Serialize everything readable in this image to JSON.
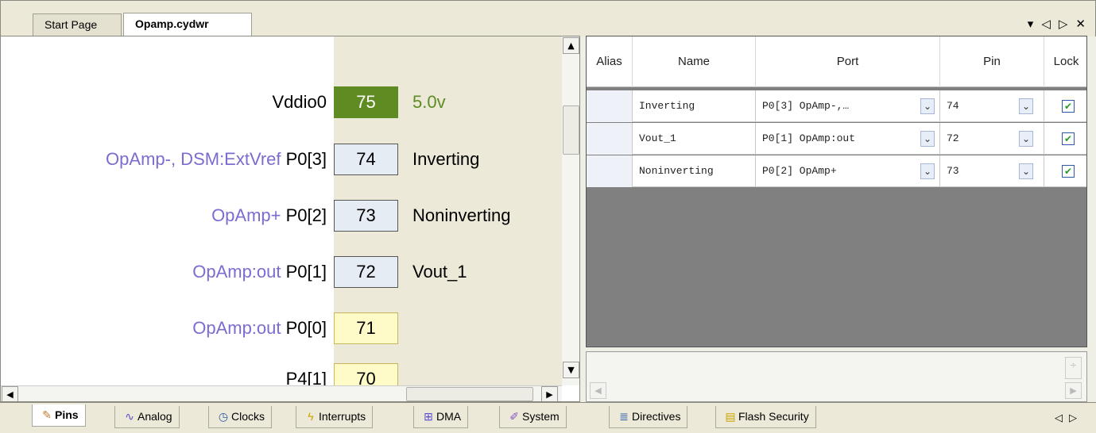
{
  "doc_tabs": [
    {
      "label": "Start Page"
    },
    {
      "label": "Opamp.cydwr"
    }
  ],
  "window_controls": {
    "dropdown": "▾",
    "prev": "◁",
    "next": "▷",
    "close": "✕"
  },
  "pins": [
    {
      "func": "",
      "port": "Vddio0",
      "number": "75",
      "name": "5.0v",
      "style": "green"
    },
    {
      "func": "OpAmp-, DSM:ExtVref",
      "port": "P0[3]",
      "number": "74",
      "name": "Inverting",
      "style": "assigned"
    },
    {
      "func": "OpAmp+",
      "port": "P0[2]",
      "number": "73",
      "name": "Noninverting",
      "style": "assigned"
    },
    {
      "func": "OpAmp:out",
      "port": "P0[1]",
      "number": "72",
      "name": "Vout_1",
      "style": "assigned"
    },
    {
      "func": "OpAmp:out",
      "port": "P0[0]",
      "number": "71",
      "name": "",
      "style": "free"
    },
    {
      "func": "",
      "port": "P4[1]",
      "number": "70",
      "name": "",
      "style": "free"
    }
  ],
  "grid": {
    "headers": {
      "alias": "Alias",
      "name": "Name",
      "port": "Port",
      "pin": "Pin",
      "lock": "Lock"
    },
    "rows": [
      {
        "alias": "",
        "name": "Inverting",
        "port": "P0[3] OpAmp-,…",
        "pin": "74",
        "locked": true
      },
      {
        "alias": "",
        "name": "Vout_1",
        "port": "P0[1] OpAmp:out",
        "pin": "72",
        "locked": true
      },
      {
        "alias": "",
        "name": "Noninverting",
        "port": "P0[2] OpAmp+",
        "pin": "73",
        "locked": true
      }
    ]
  },
  "bottom_tabs": [
    {
      "label": "Pins",
      "icon": "pins-icon",
      "glyph": "✎"
    },
    {
      "label": "Analog",
      "icon": "analog-icon",
      "glyph": "∿"
    },
    {
      "label": "Clocks",
      "icon": "clock-icon",
      "glyph": "◷"
    },
    {
      "label": "Interrupts",
      "icon": "lightning-icon",
      "glyph": "ϟ"
    },
    {
      "label": "DMA",
      "icon": "dma-icon",
      "glyph": "⊞"
    },
    {
      "label": "System",
      "icon": "system-icon",
      "glyph": "✐"
    },
    {
      "label": "Directives",
      "icon": "directives-icon",
      "glyph": "≣"
    },
    {
      "label": "Flash Security",
      "icon": "flash-security-icon",
      "glyph": "▤"
    }
  ],
  "colors": {
    "accent_green": "#5e8c23",
    "function_text": "#7b6ccf",
    "free_pin": "#fffbc8"
  }
}
